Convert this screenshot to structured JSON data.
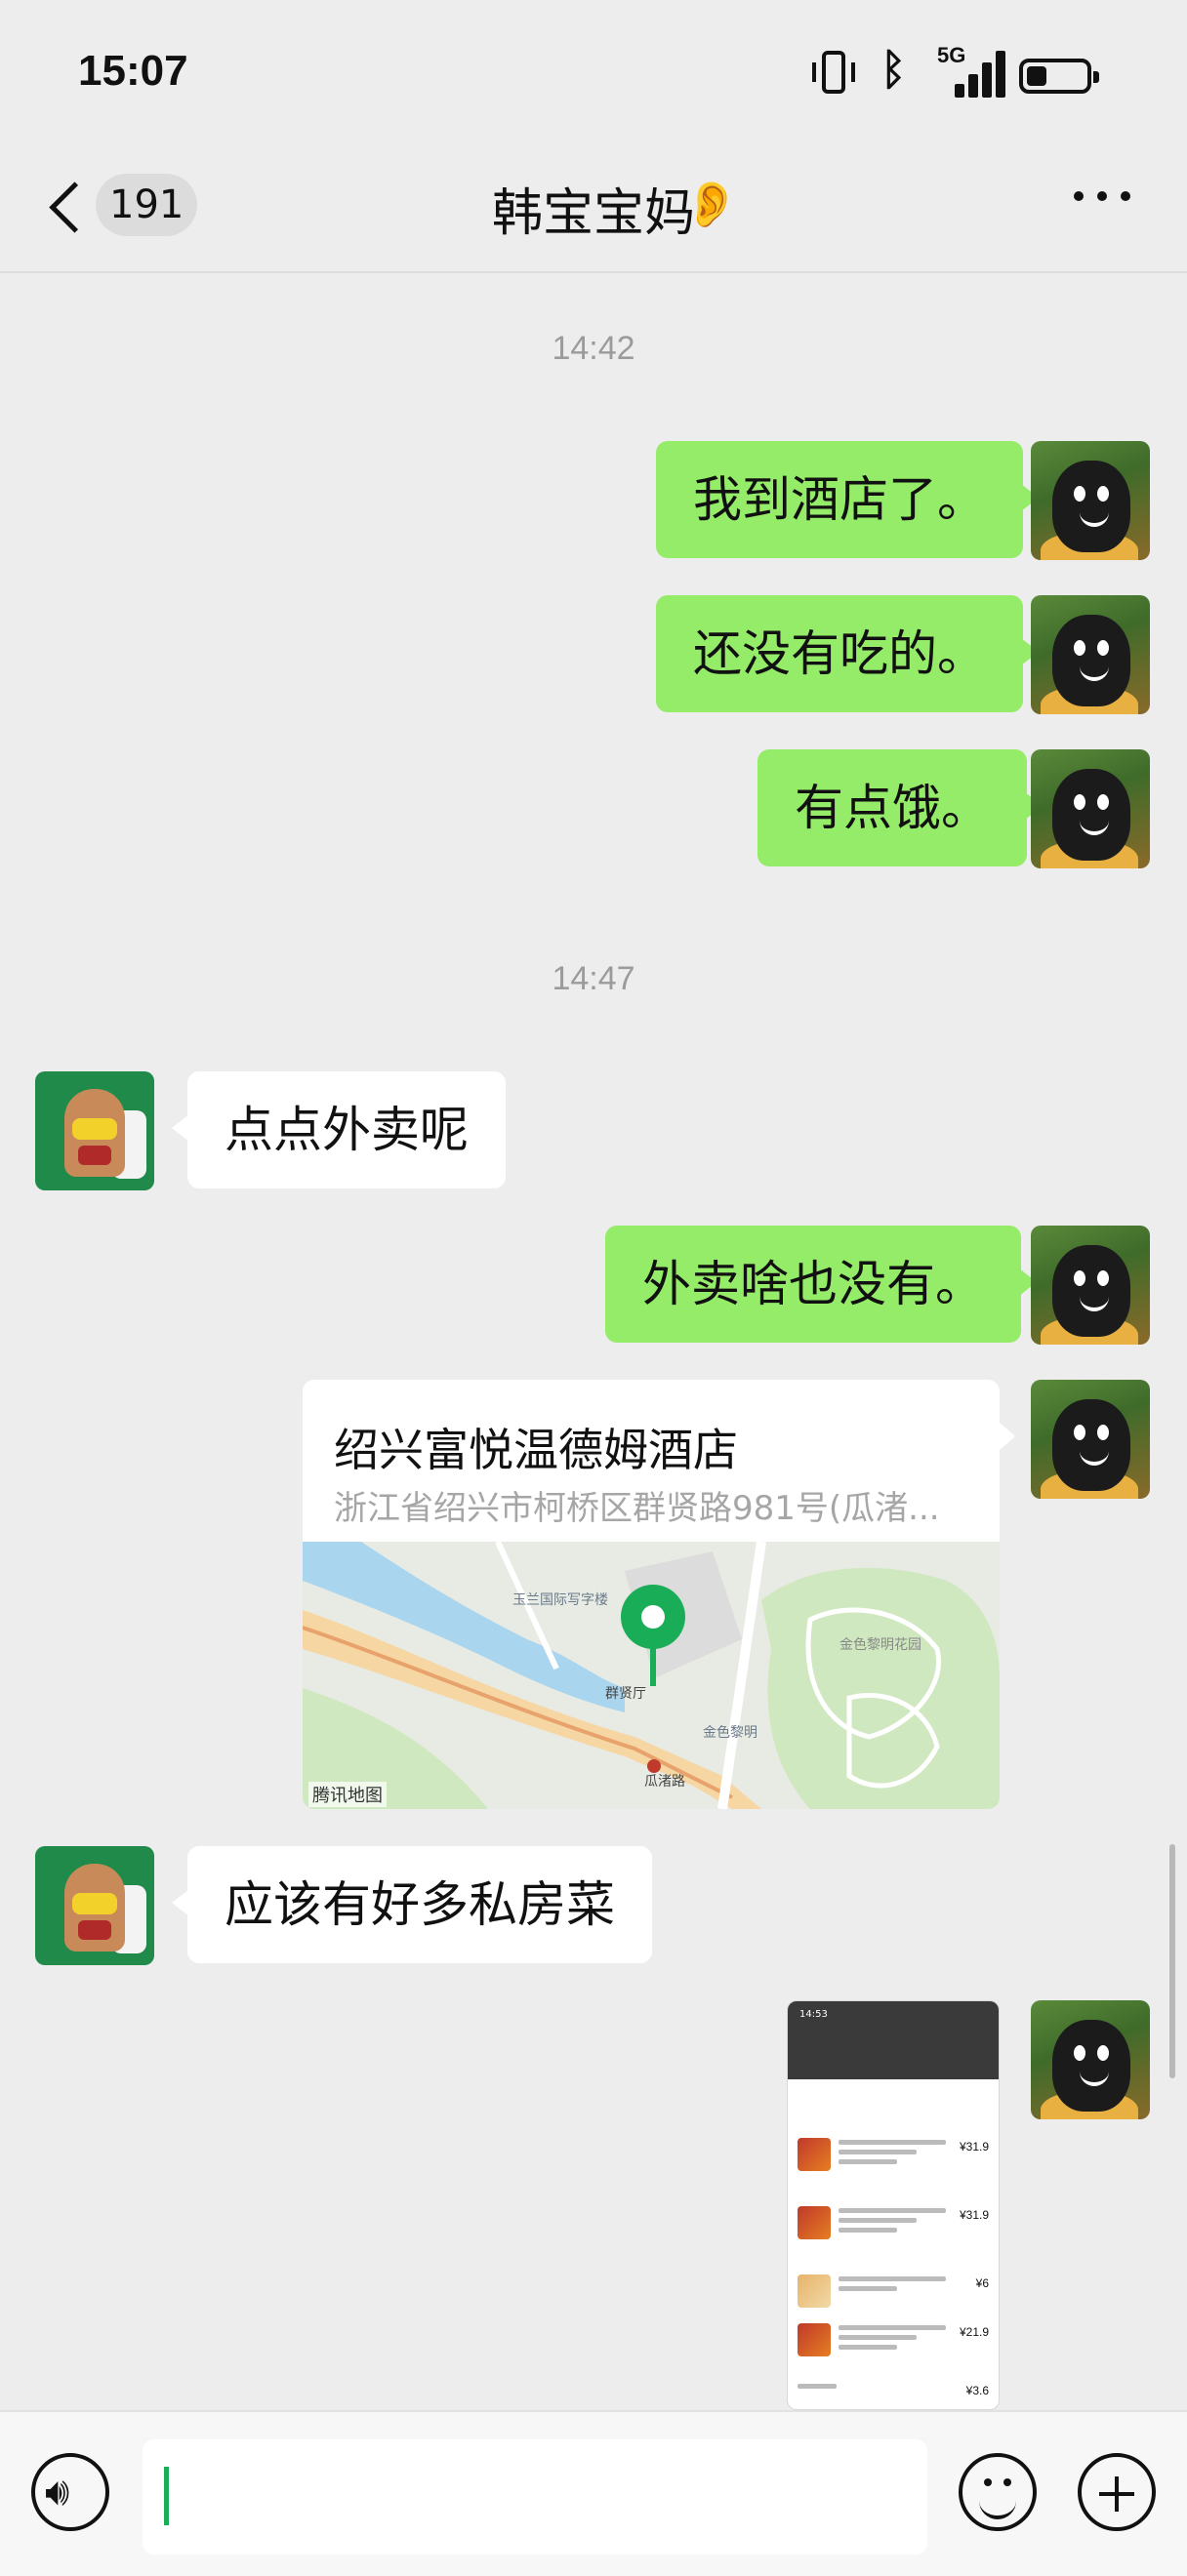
{
  "status_bar": {
    "time": "15:07",
    "network": "5G",
    "battery_level": 0.35
  },
  "nav": {
    "back_count": "191",
    "title": "韩宝宝妈",
    "ear_icon": "ear-icon",
    "more_icon": "more-icon"
  },
  "timestamps": [
    "14:42",
    "14:47"
  ],
  "messages": [
    {
      "sender": "me",
      "text": "我到酒店了。"
    },
    {
      "sender": "me",
      "text": "还没有吃的。"
    },
    {
      "sender": "me",
      "text": "有点饿。"
    },
    {
      "sender": "other",
      "text": "点点外卖呢"
    },
    {
      "sender": "me",
      "text": "外卖啥也没有。"
    },
    {
      "sender": "me",
      "type": "location",
      "name": "绍兴富悦温德姆酒店",
      "address": "浙江省绍兴市柯桥区群贤路981号(瓜渚...",
      "map_credit": "腾讯地图"
    },
    {
      "sender": "other",
      "text": "应该有好多私房菜"
    },
    {
      "sender": "me",
      "type": "image",
      "caption": "screenshot"
    }
  ],
  "thumbnail": {
    "time": "14:53",
    "prices": [
      "¥31.9",
      "¥31.9",
      "¥6",
      "¥21.9",
      "¥3.6"
    ]
  },
  "input_bar": {
    "voice_icon": "voice-icon",
    "emoji_icon": "emoji-icon",
    "plus_icon": "plus-icon"
  },
  "colors": {
    "bubble_me": "#95ec69",
    "bubble_other": "#ffffff",
    "background": "#ededed",
    "accent": "#1aad58"
  }
}
